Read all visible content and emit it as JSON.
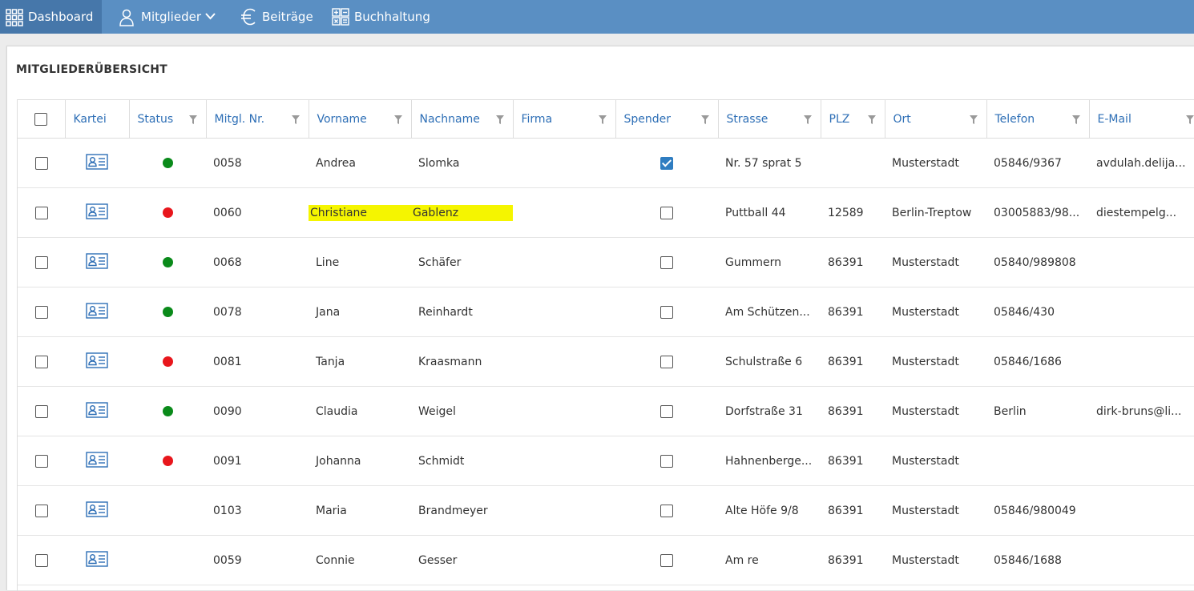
{
  "nav": {
    "items": [
      {
        "label": "Dashboard",
        "icon": "grid-icon"
      },
      {
        "label": "Mitglieder",
        "icon": "user-icon"
      },
      {
        "label": "Beiträge",
        "icon": "euro-icon"
      },
      {
        "label": "Buchhaltung",
        "icon": "calculator-icon"
      }
    ]
  },
  "panel": {
    "title": "MITGLIEDERÜBERSICHT"
  },
  "table": {
    "columns": [
      "Kartei",
      "Status",
      "Mitgl. Nr.",
      "Vorname",
      "Nachname",
      "Firma",
      "Spender",
      "Strasse",
      "PLZ",
      "Ort",
      "Telefon",
      "E-Mail"
    ],
    "rows": [
      {
        "status_color": "#0a8a1a",
        "nr": "0058",
        "vorname": "Andrea",
        "nachname": "Slomka",
        "firma": "",
        "spender": true,
        "strasse": "Nr. 57 sprat 5",
        "plz": "",
        "ort": "Musterstadt",
        "telefon": "05846/9367",
        "email": "avdulah.delija..."
      },
      {
        "status_color": "#e8161c",
        "nr": "0060",
        "vorname": "Christiane",
        "nachname": "Gablenz",
        "firma": "",
        "spender": false,
        "strasse": "Puttball 44",
        "plz": "12589",
        "ort": "Berlin-Treptow",
        "telefon": "03005883/98...",
        "email": "diestempelg...",
        "highlight": true
      },
      {
        "status_color": "#0a8a1a",
        "nr": "0068",
        "vorname": "Line",
        "nachname": "Schäfer",
        "firma": "",
        "spender": false,
        "strasse": "Gummern",
        "plz": "86391",
        "ort": "Musterstadt",
        "telefon": "05840/989808",
        "email": ""
      },
      {
        "status_color": "#0a8a1a",
        "nr": "0078",
        "vorname": "Jana",
        "nachname": "Reinhardt",
        "firma": "",
        "spender": false,
        "strasse": "Am Schützen...",
        "plz": "86391",
        "ort": "Musterstadt",
        "telefon": "05846/430",
        "email": ""
      },
      {
        "status_color": "#e8161c",
        "nr": "0081",
        "vorname": "Tanja",
        "nachname": "Kraasmann",
        "firma": "",
        "spender": false,
        "strasse": "Schulstraße 6",
        "plz": "86391",
        "ort": "Musterstadt",
        "telefon": "05846/1686",
        "email": ""
      },
      {
        "status_color": "#0a8a1a",
        "nr": "0090",
        "vorname": "Claudia",
        "nachname": "Weigel",
        "firma": "",
        "spender": false,
        "strasse": "Dorfstraße 31",
        "plz": "86391",
        "ort": "Musterstadt",
        "telefon": "Berlin",
        "email": "dirk-bruns@li..."
      },
      {
        "status_color": "#e8161c",
        "nr": "0091",
        "vorname": "Johanna",
        "nachname": "Schmidt",
        "firma": "",
        "spender": false,
        "strasse": "Hahnenberge...",
        "plz": "86391",
        "ort": "Musterstadt",
        "telefon": "",
        "email": ""
      },
      {
        "status_color": "",
        "nr": "0103",
        "vorname": "Maria",
        "nachname": "Brandmeyer",
        "firma": "",
        "spender": false,
        "strasse": "Alte Höfe 9/8",
        "plz": "86391",
        "ort": "Musterstadt",
        "telefon": "05846/980049",
        "email": ""
      },
      {
        "status_color": "",
        "nr": "0059",
        "vorname": "Connie",
        "nachname": "Gesser",
        "firma": "",
        "spender": false,
        "strasse": "Am re",
        "plz": "86391",
        "ort": "Musterstadt",
        "telefon": "05846/1688",
        "email": ""
      }
    ]
  },
  "colors": {
    "topbar": "#5a8fc3",
    "active_nav": "#4677aa",
    "header_text": "#2e6fb6",
    "highlight": "#f5f500"
  }
}
